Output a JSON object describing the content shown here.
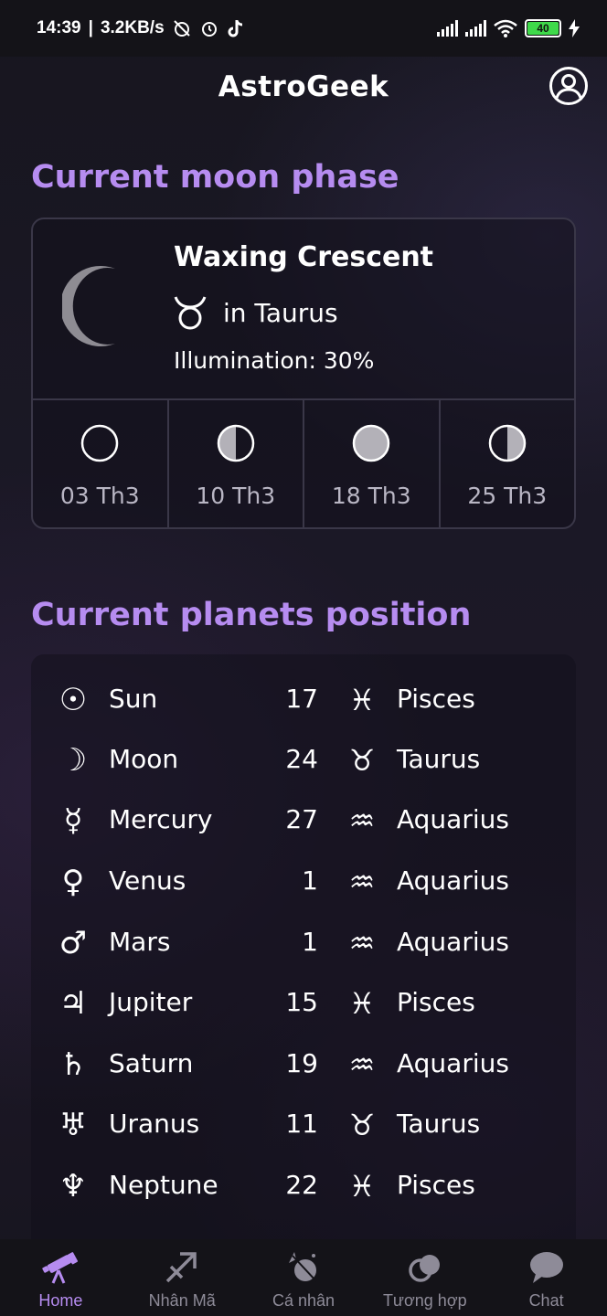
{
  "status_bar": {
    "time": "14:39",
    "speed": "3.2KB/s",
    "battery": "40"
  },
  "header": {
    "title": "AstroGeek",
    "profile_icon": "user-circle-icon"
  },
  "moon_section": {
    "title": "Current moon phase",
    "phase_name": "Waxing Crescent",
    "sign_icon": "taurus-icon",
    "sign_text": "in Taurus",
    "illumination": "Illumination: 30%",
    "upcoming": [
      {
        "icon": "new-moon-icon",
        "date": "03 Th3"
      },
      {
        "icon": "first-quarter-icon",
        "date": "10 Th3"
      },
      {
        "icon": "full-moon-icon",
        "date": "18 Th3"
      },
      {
        "icon": "last-quarter-icon",
        "date": "25 Th3"
      }
    ]
  },
  "planets_section": {
    "title": "Current planets position",
    "planets": [
      {
        "glyph": "☉",
        "icon": "sun-icon",
        "name": "Sun",
        "degree": "17",
        "sign_glyph": "♓",
        "sign": "Pisces"
      },
      {
        "glyph": "☽",
        "icon": "moon-icon",
        "name": "Moon",
        "degree": "24",
        "sign_glyph": "♉",
        "sign": "Taurus"
      },
      {
        "glyph": "☿",
        "icon": "mercury-icon",
        "name": "Mercury",
        "degree": "27",
        "sign_glyph": "♒",
        "sign": "Aquarius"
      },
      {
        "glyph": "♀",
        "icon": "venus-icon",
        "name": "Venus",
        "degree": "1",
        "sign_glyph": "♒",
        "sign": "Aquarius"
      },
      {
        "glyph": "♂",
        "icon": "mars-icon",
        "name": "Mars",
        "degree": "1",
        "sign_glyph": "♒",
        "sign": "Aquarius"
      },
      {
        "glyph": "♃",
        "icon": "jupiter-icon",
        "name": "Jupiter",
        "degree": "15",
        "sign_glyph": "♓",
        "sign": "Pisces"
      },
      {
        "glyph": "♄",
        "icon": "saturn-icon",
        "name": "Saturn",
        "degree": "19",
        "sign_glyph": "♒",
        "sign": "Aquarius"
      },
      {
        "glyph": "♅",
        "icon": "uranus-icon",
        "name": "Uranus",
        "degree": "11",
        "sign_glyph": "♉",
        "sign": "Taurus"
      },
      {
        "glyph": "♆",
        "icon": "neptune-icon",
        "name": "Neptune",
        "degree": "22",
        "sign_glyph": "♓",
        "sign": "Pisces"
      }
    ]
  },
  "bottom_nav": {
    "items": [
      {
        "label": "Home",
        "icon": "telescope-icon",
        "active": true
      },
      {
        "label": "Nhân Mã",
        "icon": "sagittarius-icon",
        "active": false
      },
      {
        "label": "Cá nhân",
        "icon": "personal-chart-icon",
        "active": false
      },
      {
        "label": "Tương hợp",
        "icon": "compatibility-icon",
        "active": false
      },
      {
        "label": "Chat",
        "icon": "chat-bubble-icon",
        "active": false
      }
    ]
  },
  "colors": {
    "accent": "#b68cf0",
    "background": "#17151f",
    "border": "#3a3748",
    "muted_text": "#b9b6c4"
  }
}
